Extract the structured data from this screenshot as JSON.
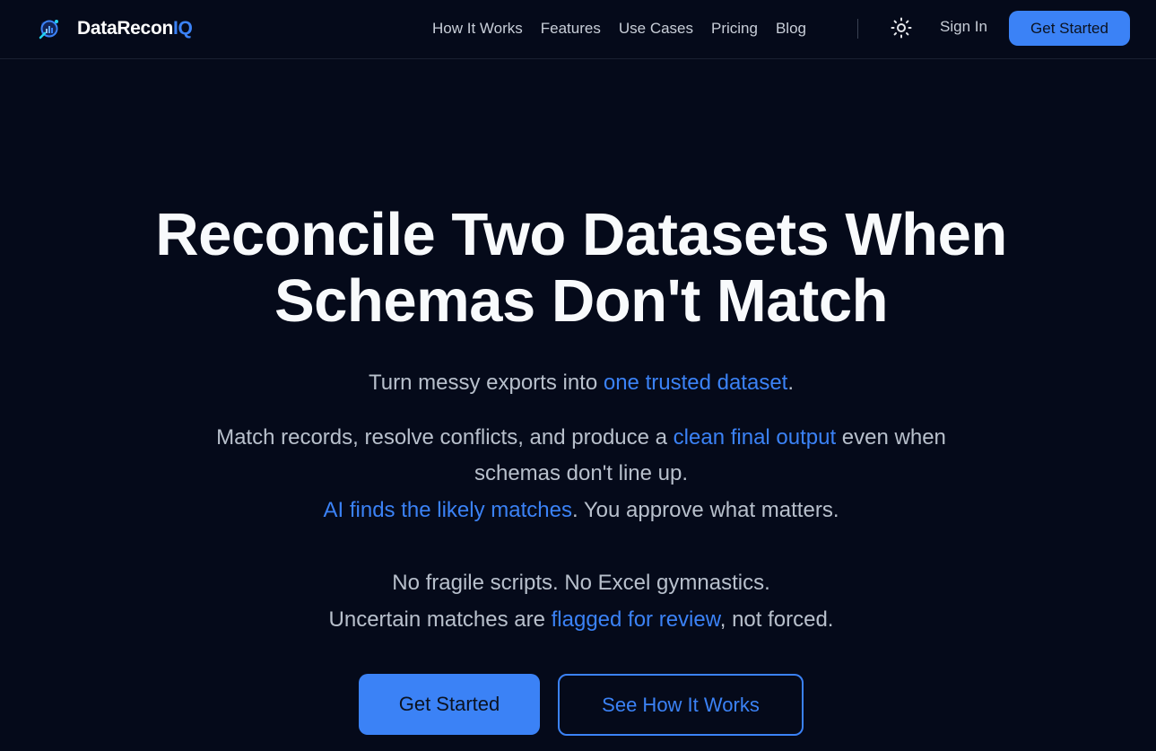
{
  "brand": {
    "name_main": "DataRecon",
    "name_accent": "IQ",
    "accent_color": "#3b82f6",
    "logo_icon": "dataset-reconcile-icon"
  },
  "nav": {
    "links": [
      {
        "label": "How It Works"
      },
      {
        "label": "Features"
      },
      {
        "label": "Use Cases"
      },
      {
        "label": "Pricing"
      },
      {
        "label": "Blog"
      }
    ],
    "theme_toggle_icon": "sun-icon",
    "sign_in": "Sign In",
    "cta": "Get Started"
  },
  "hero": {
    "title_line1": "Reconcile Two Datasets When",
    "title_line2": "Schemas Don't Match",
    "tagline": {
      "pre": "Turn messy exports into ",
      "highlight": "one trusted dataset",
      "post": "."
    },
    "desc_line1": {
      "pre": "Match records, resolve conflicts, and produce a ",
      "highlight": "clean final output",
      "post": " even when"
    },
    "desc_line2": "schemas don't line up.",
    "desc_line3": {
      "highlight": "AI finds the likely matches",
      "post": ". You approve what matters."
    },
    "desc_line4": "No fragile scripts. No Excel gymnastics.",
    "desc_line5": {
      "pre": "Uncertain matches are ",
      "highlight": "flagged for review",
      "post": ", not forced."
    },
    "primary_cta": "Get Started",
    "secondary_cta": "See How It Works"
  },
  "colors": {
    "background": "#050a1a",
    "text_muted": "#b8c0cc",
    "nav_text": "#c8ced8",
    "primary": "#3b82f6"
  }
}
